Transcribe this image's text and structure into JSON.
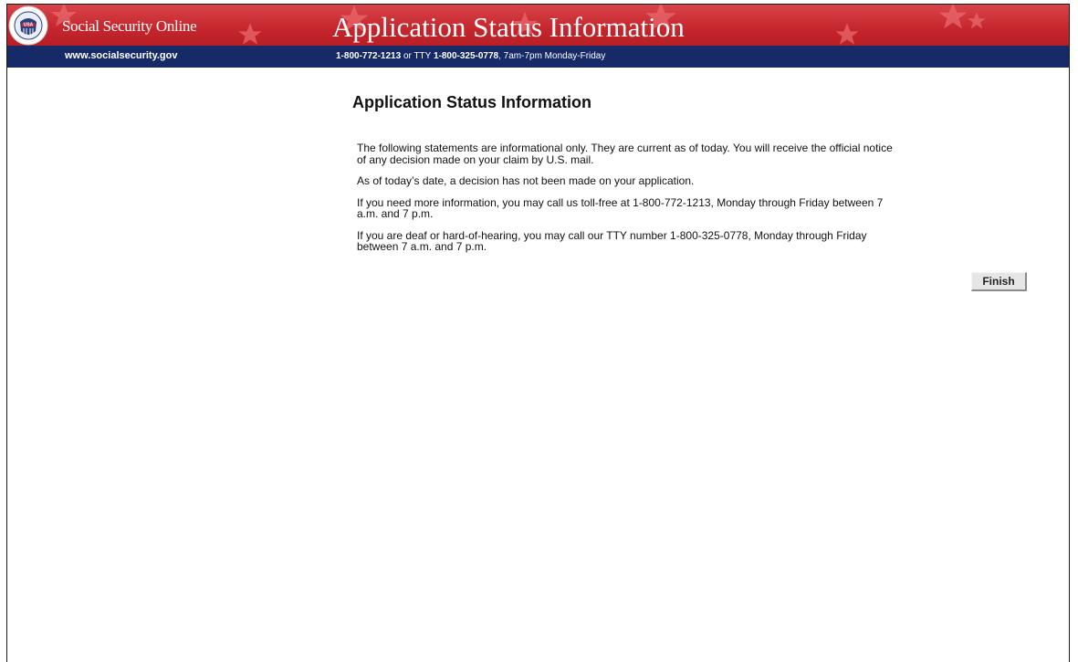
{
  "banner": {
    "site_name": "Social Security Online",
    "title": "Application Status Information",
    "seal_text": "USA",
    "seal_ring_text": "SOCIAL SECURITY ADMINISTRATION"
  },
  "infobar": {
    "url": "www.socialsecurity.gov",
    "phone": "1-800-772-1213",
    "or_tty": " or TTY ",
    "tty": "1-800-325-0778",
    "hours": ", 7am-7pm Monday-Friday"
  },
  "main": {
    "heading": "Application Status Information",
    "paragraphs": [
      "The following statements are informational only. They are current as of today. You will receive the official notice of any decision made on your claim by U.S. mail.",
      "As of today’s date, a decision has not been made on your application.",
      "If you need more information, you may call us toll-free at 1-800-772-1213, Monday through Friday between 7 a.m. and 7 p.m.",
      "If you are deaf or hard-of-hearing, you may call our TTY number 1-800-325-0778, Monday through Friday between 7 a.m. and 7 p.m."
    ],
    "finish_label": "Finish"
  },
  "colors": {
    "banner_red": "#c4262c",
    "infobar_navy": "#152a66"
  }
}
